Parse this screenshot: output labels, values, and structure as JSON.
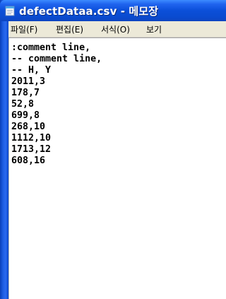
{
  "window": {
    "title": "defectDataa.csv - 메모장"
  },
  "menu": [
    {
      "label": "파일(F)"
    },
    {
      "label": "편집(E)"
    },
    {
      "label": "서식(O)"
    },
    {
      "label": "보기"
    }
  ],
  "editor": {
    "lines": [
      ":comment line,",
      "-- comment line,",
      "-- H, Y",
      "2011,3",
      "178,7",
      "52,8",
      "699,8",
      "268,10",
      "1112,10",
      "1713,12",
      "608,16"
    ]
  },
  "colors": {
    "titlebar": "#0b4fd9",
    "menubar": "#ece9d8",
    "text": "#000000"
  },
  "icons": {
    "app": "notepad-icon"
  }
}
